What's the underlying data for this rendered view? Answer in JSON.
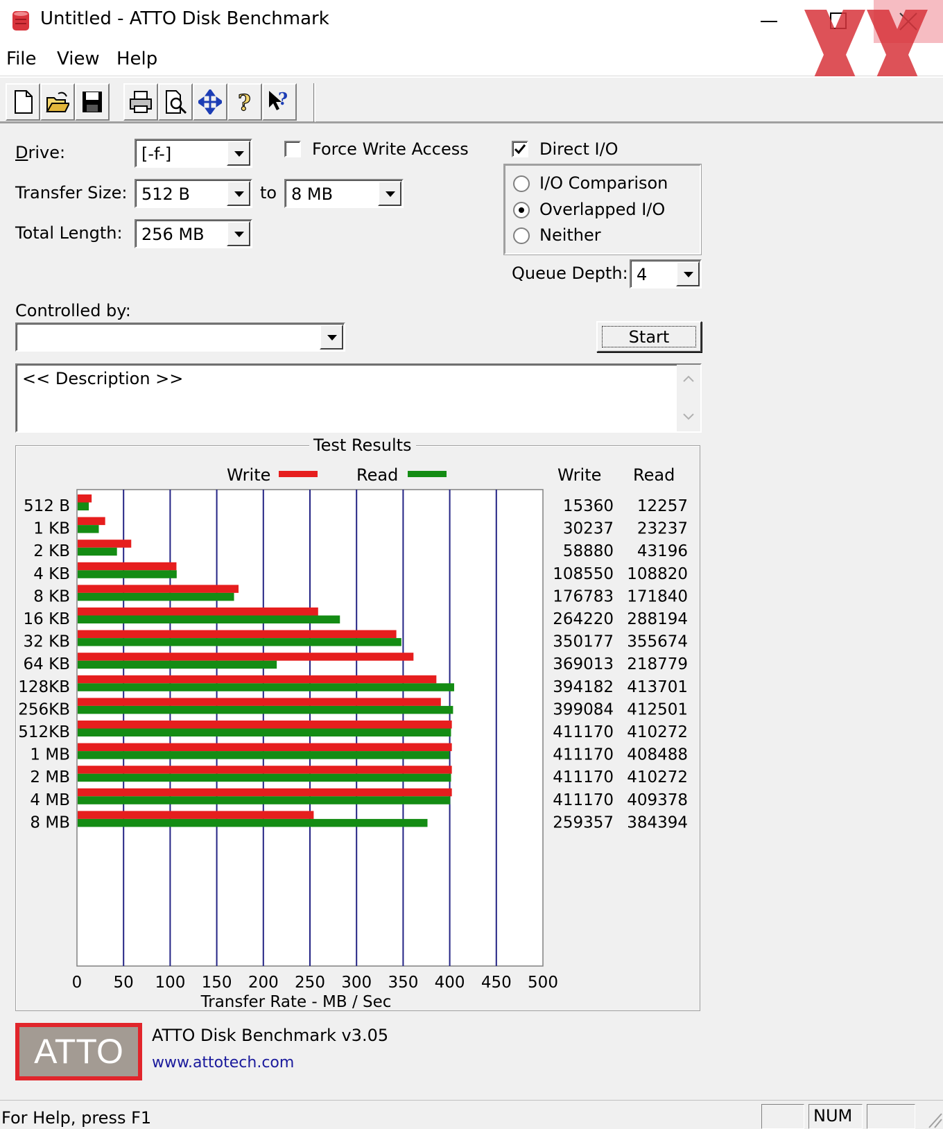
{
  "window": {
    "title": "Untitled - ATTO Disk Benchmark",
    "menu": [
      "File",
      "View",
      "Help"
    ]
  },
  "toolbar": {
    "buttons": [
      "new-icon",
      "open-icon",
      "save-icon",
      "print-icon",
      "print-preview-icon",
      "move-icon",
      "help-icon",
      "context-help-icon"
    ]
  },
  "settings": {
    "drive_label": "Drive:",
    "drive_value": "[-f-]",
    "force_write_label": "Force Write Access",
    "force_write_checked": false,
    "direct_io_label": "Direct I/O",
    "direct_io_checked": true,
    "transfer_size_label": "Transfer Size:",
    "transfer_from": "512 B",
    "to_label": "to",
    "transfer_to": "8 MB",
    "total_length_label": "Total Length:",
    "total_length": "256 MB",
    "io_options": [
      {
        "label": "I/O Comparison",
        "selected": false
      },
      {
        "label": "Overlapped I/O",
        "selected": true
      },
      {
        "label": "Neither",
        "selected": false
      }
    ],
    "queue_depth_label": "Queue Depth:",
    "queue_depth": "4",
    "controlled_by_label": "Controlled by:",
    "controlled_by": "",
    "start_label": "Start",
    "description": "<< Description >>"
  },
  "results": {
    "group_title": "Test Results",
    "legend_write": "Write",
    "legend_read": "Read",
    "col_write": "Write",
    "col_read": "Read",
    "write_color": "#e61e1e",
    "read_color": "#148c14"
  },
  "chart_data": {
    "type": "bar",
    "orientation": "horizontal",
    "categories": [
      "512 B",
      "1 KB",
      "2 KB",
      "4 KB",
      "8 KB",
      "16 KB",
      "32 KB",
      "64 KB",
      "128KB",
      "256KB",
      "512KB",
      "1 MB",
      "2 MB",
      "4 MB",
      "8 MB"
    ],
    "series": [
      {
        "name": "Write",
        "values": [
          15360,
          30237,
          58880,
          108550,
          176783,
          264220,
          350177,
          369013,
          394182,
          399084,
          411170,
          411170,
          411170,
          411170,
          259357
        ]
      },
      {
        "name": "Read",
        "values": [
          12257,
          23237,
          43196,
          108820,
          171840,
          288194,
          355674,
          218779,
          413701,
          412501,
          410272,
          408488,
          410272,
          409378,
          384394
        ]
      }
    ],
    "x_ticks": [
      0,
      50,
      100,
      150,
      200,
      250,
      300,
      350,
      400,
      450,
      500
    ],
    "xlim": [
      0,
      500
    ],
    "xlabel": "Transfer Rate - MB / Sec",
    "grid": true,
    "legend": "top"
  },
  "footer": {
    "logo_text": "ATTO",
    "version": "ATTO Disk Benchmark v3.05",
    "website": "www.attotech.com"
  },
  "status": {
    "help_text": "For Help, press F1",
    "num": "NUM"
  }
}
